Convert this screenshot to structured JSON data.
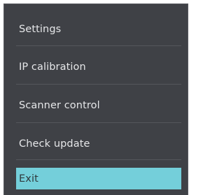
{
  "menu": {
    "items": [
      {
        "label": "Settings"
      },
      {
        "label": "IP calibration"
      },
      {
        "label": "Scanner control"
      },
      {
        "label": "Check update"
      },
      {
        "label": "Exit",
        "highlighted": true
      }
    ]
  },
  "colors": {
    "menu_background": "#3f4146",
    "text": "#e6e7e9",
    "divider": "#55575c",
    "highlight": "#74cfda"
  }
}
